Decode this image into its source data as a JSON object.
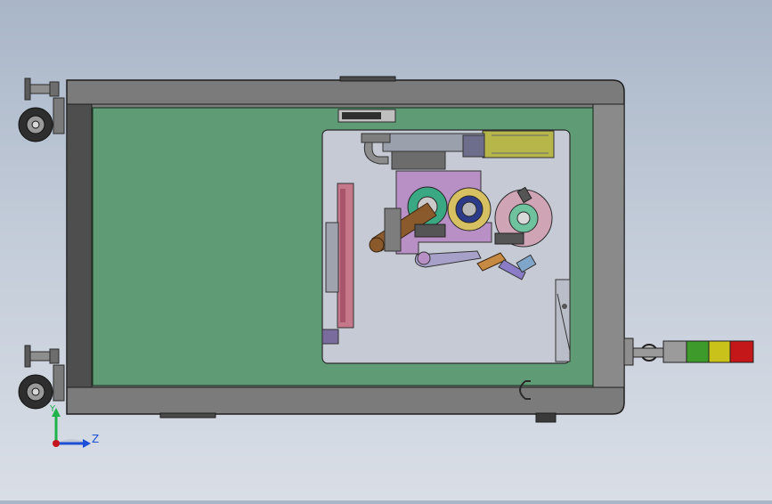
{
  "view": {
    "title": "",
    "background_top": "#a9b6c8",
    "background_bottom": "#d9dee6"
  },
  "triad": {
    "y_label": "Y",
    "z_label": "Z",
    "y_color": "#1fb34a",
    "z_color": "#1c4fd6",
    "origin_color": "#c4141c"
  },
  "colors": {
    "frame": "#7b7b7b",
    "panel": "#5f9b74",
    "window": "#c5cad5",
    "light_green": "#3f9a2c",
    "light_yellow": "#c9c21b",
    "light_red": "#c3171a",
    "motor": "#b7b64a",
    "purple_plate": "#b890c6",
    "brown_arm": "#8a5a2c",
    "pink_rail": "#c4788a"
  },
  "tower_light": {
    "segments": [
      "grey",
      "green",
      "yellow",
      "red"
    ]
  }
}
